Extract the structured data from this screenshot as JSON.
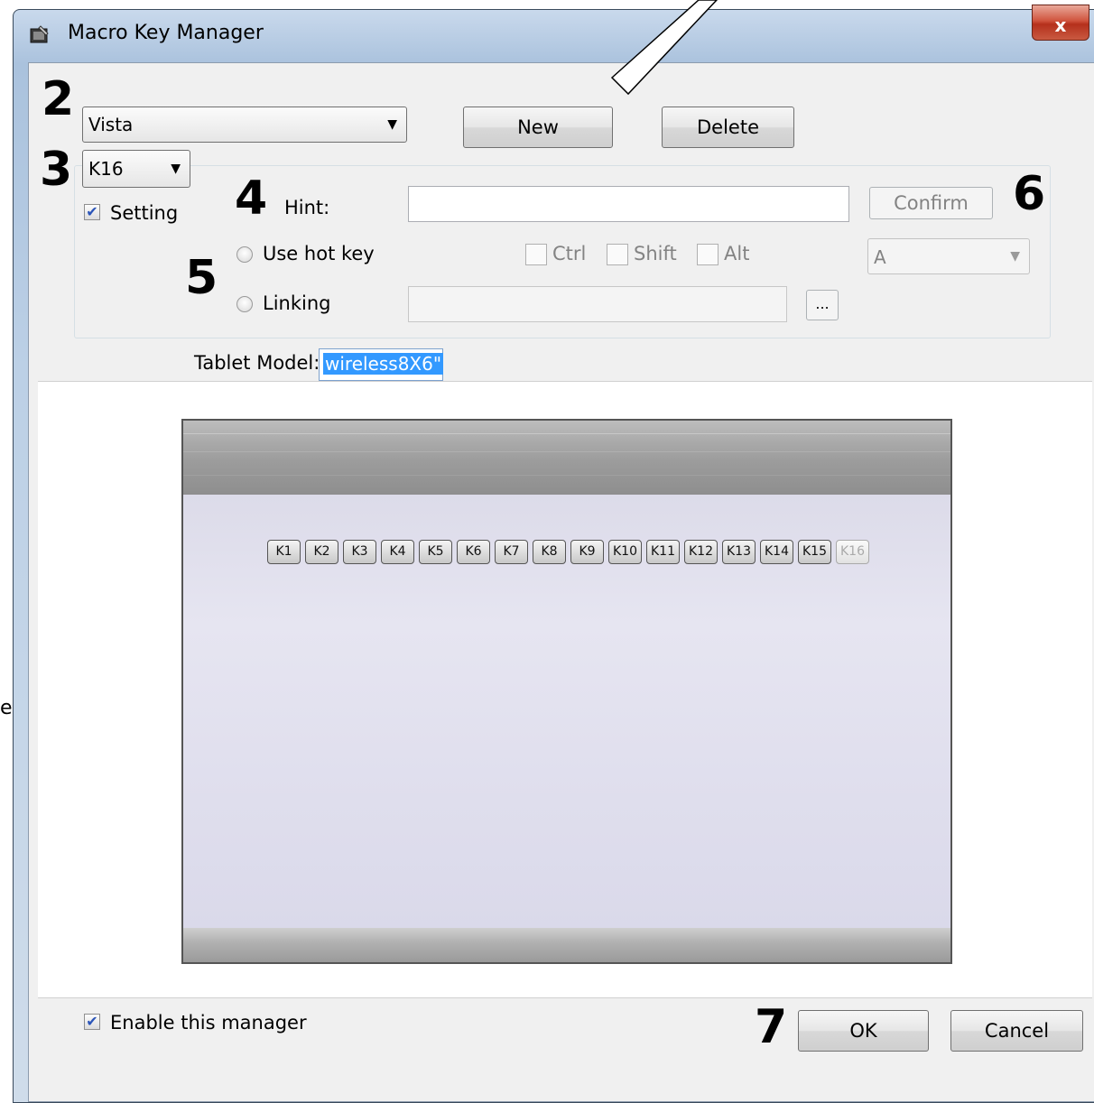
{
  "window": {
    "title": "Macro Key Manager",
    "close_label": "x"
  },
  "callouts": {
    "n2": "2",
    "n3": "3",
    "n4": "4",
    "n5": "5",
    "n6": "6",
    "n7": "7"
  },
  "profile": {
    "selected": "Vista",
    "new_label": "New",
    "delete_label": "Delete"
  },
  "key_select": {
    "selected": "K16"
  },
  "setting": {
    "checkbox_label": "Setting",
    "checked": true,
    "hint_label": "Hint:",
    "hint_value": "",
    "confirm_label": "Confirm",
    "use_hotkey_label": "Use hot key",
    "ctrl_label": "Ctrl",
    "shift_label": "Shift",
    "alt_label": "Alt",
    "hotkey_key": "A",
    "linking_label": "Linking",
    "linking_value": "",
    "browse_label": "..."
  },
  "tablet": {
    "model_label": "Tablet Model:",
    "model_value": "wireless8X6\"",
    "keys": [
      "K1",
      "K2",
      "K3",
      "K4",
      "K5",
      "K6",
      "K7",
      "K8",
      "K9",
      "K10",
      "K11",
      "K12",
      "K13",
      "K14",
      "K15",
      "K16"
    ],
    "inactive_key": "K16"
  },
  "footer": {
    "enable_label": "Enable this manager",
    "enable_checked": true,
    "ok_label": "OK",
    "cancel_label": "Cancel"
  },
  "left_edge_text": "e"
}
